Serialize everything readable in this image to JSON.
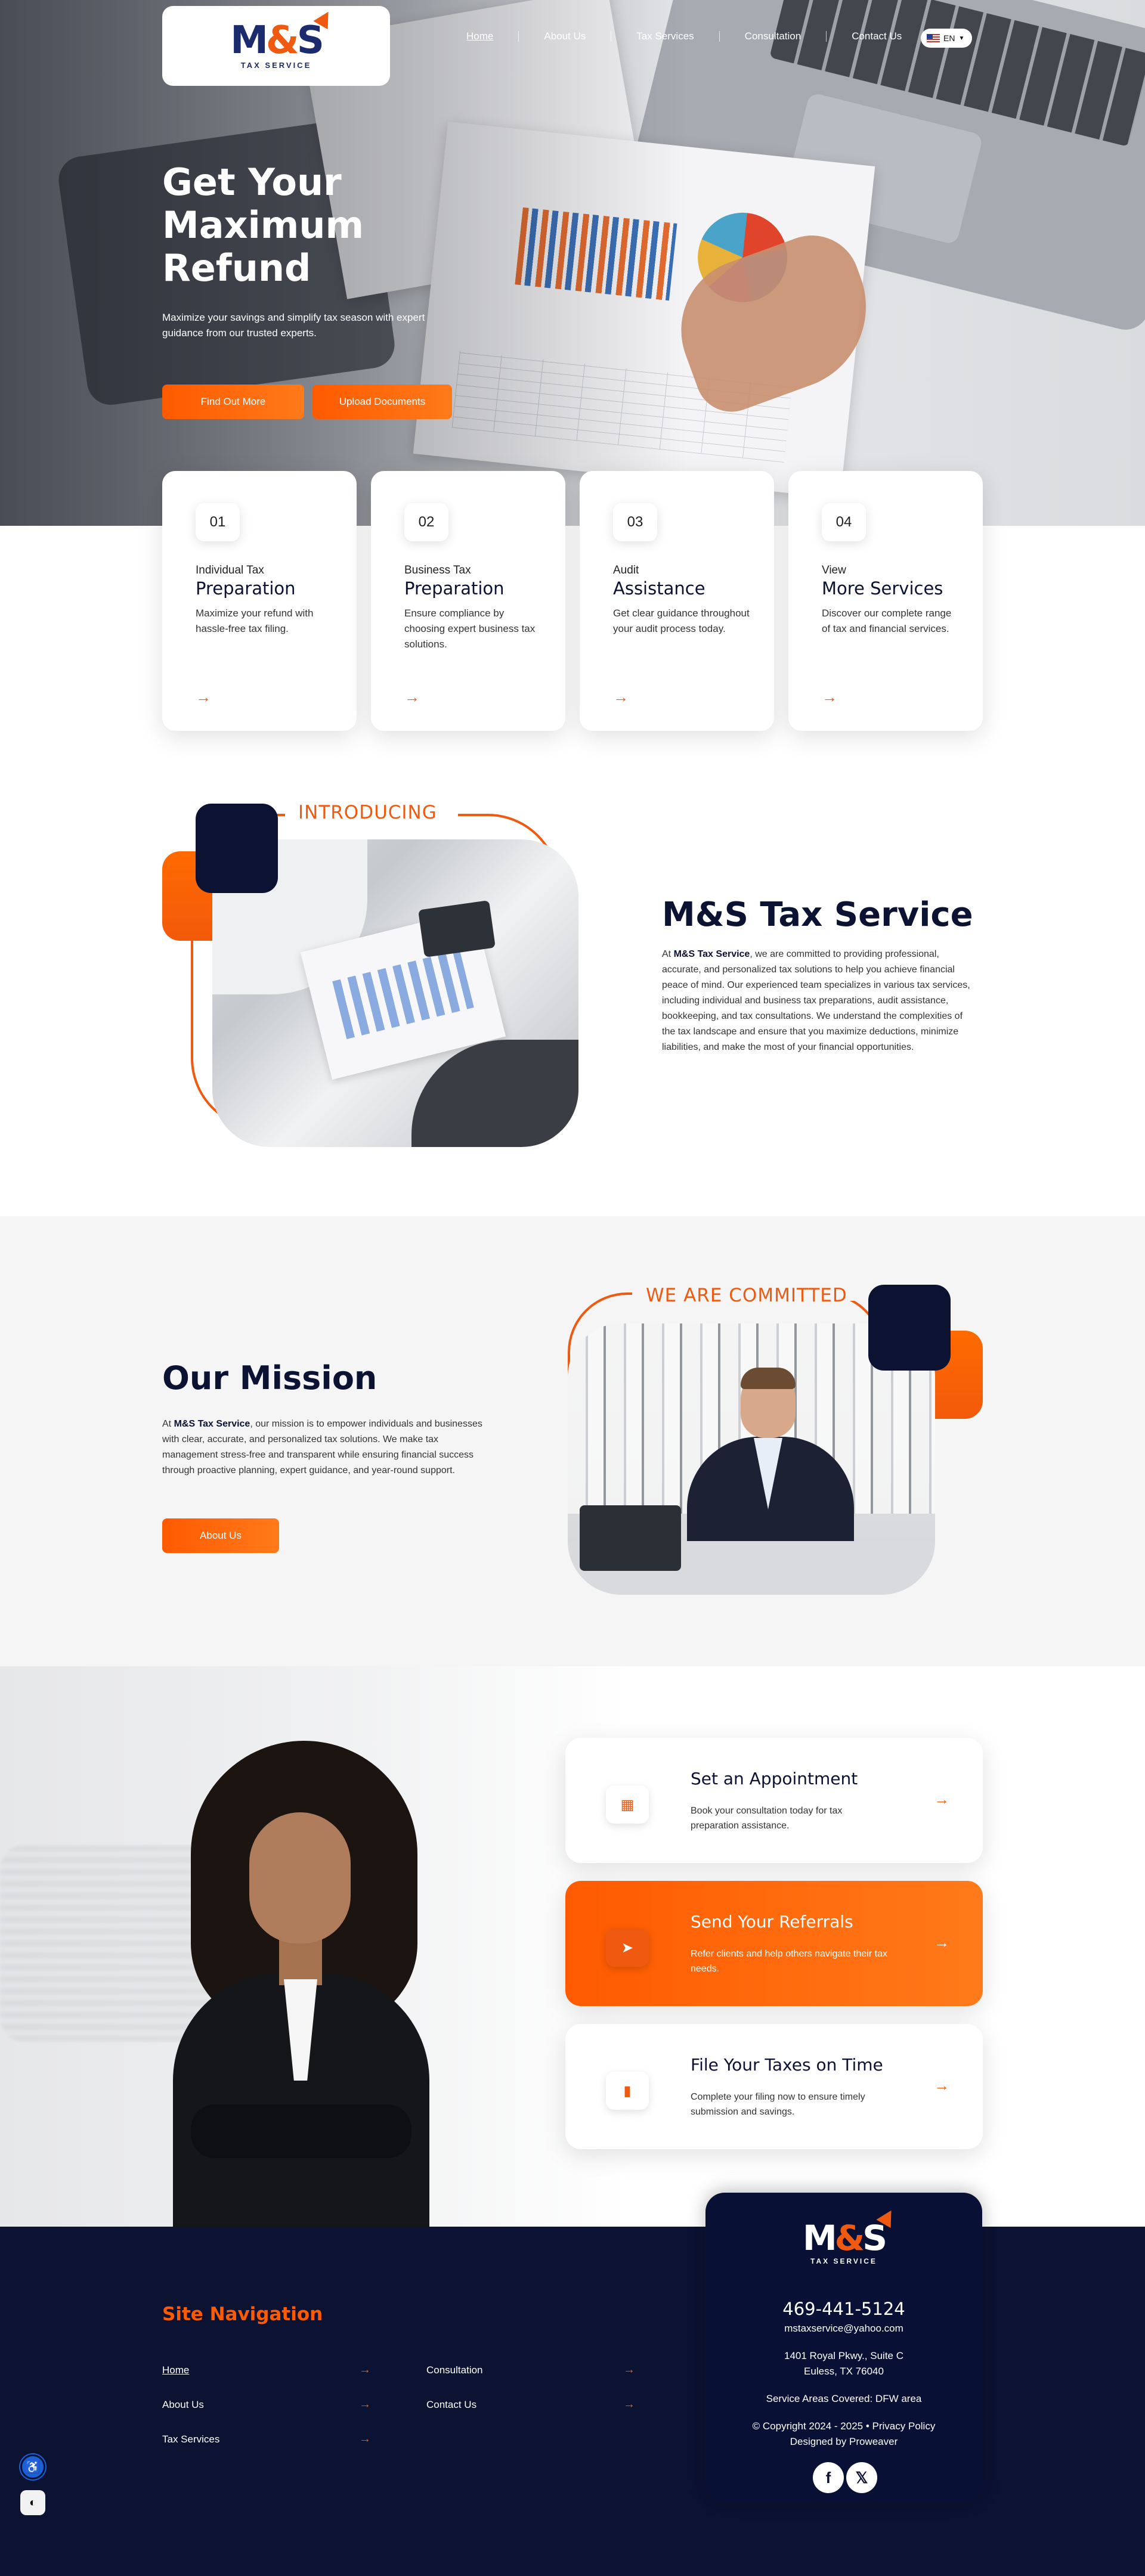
{
  "brand": {
    "logo_mark_left": "M",
    "logo_mark_amp": "&",
    "logo_mark_right": "S",
    "logo_sub": "TAX SERVICE",
    "accent": "#ef5a10",
    "navy": "#0b1232"
  },
  "nav": {
    "items": [
      "Home",
      "About Us",
      "Tax Services",
      "Consultation",
      "Contact Us"
    ],
    "lang": "EN"
  },
  "hero": {
    "title": "Get Your Maximum Refund",
    "subtitle": "Maximize your savings and simplify tax season with expert guidance from our trusted experts.",
    "btn_primary": "Find Out More",
    "btn_secondary": "Upload Documents"
  },
  "services": [
    {
      "num": "01",
      "kicker": "Individual Tax",
      "title": "Preparation",
      "desc": "Maximize your refund with hassle-free tax filing."
    },
    {
      "num": "02",
      "kicker": "Business Tax",
      "title": "Preparation",
      "desc": "Ensure compliance by choosing expert business tax solutions."
    },
    {
      "num": "03",
      "kicker": "Audit",
      "title": "Assistance",
      "desc": "Get clear guidance throughout your audit process today."
    },
    {
      "num": "04",
      "kicker": "View",
      "title": "More Services",
      "desc": "Discover our complete range of tax and financial services."
    }
  ],
  "intro": {
    "label": "INTRODUCING",
    "heading": "M&S Tax Service",
    "para_prefix": "At ",
    "para_bold": "M&S Tax Service",
    "para_rest": ", we are committed to providing professional, accurate, and personalized tax solutions to help you achieve financial peace of mind. Our experienced team specializes in various tax services, including individual and business tax preparations, audit assistance, bookkeeping, and tax consultations. We understand the complexities of the tax landscape and ensure that you maximize deductions, minimize liabilities, and make the most of your financial opportunities."
  },
  "mission": {
    "label": "WE ARE COMMITTED",
    "heading": "Our Mission",
    "para_prefix": "At ",
    "para_bold": "M&S Tax Service",
    "para_rest": ", our mission is to empower individuals and businesses with clear, accurate, and personalized tax solutions. We make tax management stress-free and transparent while ensuring financial success through proactive planning, expert guidance, and year-round support.",
    "button": "About Us"
  },
  "ctas": [
    {
      "title": "Set an Appointment",
      "desc": "Book your consultation today for tax preparation assistance.",
      "icon": "calendar-icon"
    },
    {
      "title": "Send Your Referrals",
      "desc": "Refer clients and help others navigate their tax needs.",
      "icon": "send-icon"
    },
    {
      "title": "File Your Taxes on Time",
      "desc": "Complete your filing now to ensure timely submission and savings.",
      "icon": "document-icon"
    }
  ],
  "footer": {
    "nav_heading": "Site Navigation",
    "nav_col1": [
      "Home",
      "About Us",
      "Tax Services"
    ],
    "nav_col2": [
      "Consultation",
      "Contact Us"
    ],
    "phone": "469-441-5124",
    "email": "mstaxservice@yahoo.com",
    "address_line1": "1401 Royal Pkwy., Suite C",
    "address_line2": "Euless, TX 76040",
    "service_areas": "Service Areas Covered: DFW area",
    "copyright": "© Copyright 2024 - 2025 • Privacy Policy",
    "designed_by": "Designed by Proweaver",
    "social": [
      "f",
      "𝕏"
    ]
  }
}
